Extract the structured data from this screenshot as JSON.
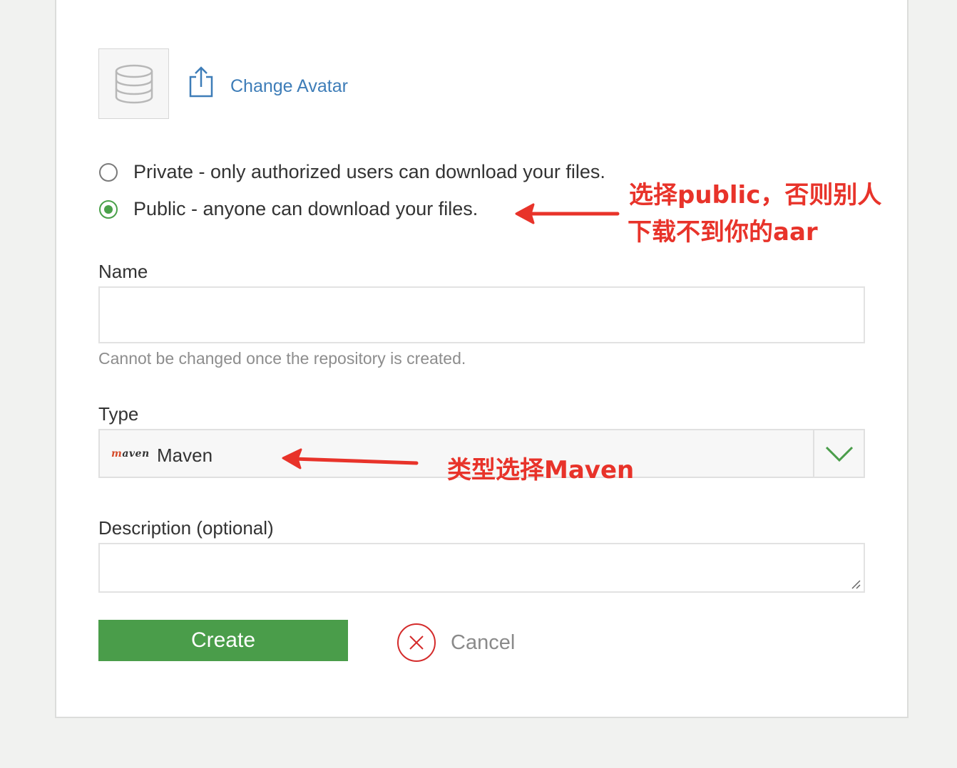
{
  "avatar": {
    "icon": "database-icon",
    "change_label": "Change Avatar",
    "change_icon": "upload-icon"
  },
  "visibility": {
    "options": [
      {
        "label": "Private - only authorized users can download your files.",
        "checked": false
      },
      {
        "label": "Public - anyone can download your files.",
        "checked": true
      }
    ]
  },
  "name_field": {
    "label": "Name",
    "value": "",
    "hint": "Cannot be changed once the repository is created."
  },
  "type_field": {
    "label": "Type",
    "logo_text": "maven",
    "selected": "Maven",
    "icon": "chevron-down-icon"
  },
  "description_field": {
    "label": "Description (optional)",
    "value": ""
  },
  "actions": {
    "create_label": "Create",
    "cancel_label": "Cancel",
    "cancel_icon": "close-circle-icon"
  },
  "annotations": {
    "public_note_line1": "选择public，否则别人",
    "public_note_line2": "下载不到你的aar",
    "type_note": "类型选择Maven"
  },
  "colors": {
    "primary_green": "#4a9d4a",
    "link_blue": "#3e7db8",
    "annotation_red": "#e8332a",
    "cancel_red": "#d42b2b"
  }
}
